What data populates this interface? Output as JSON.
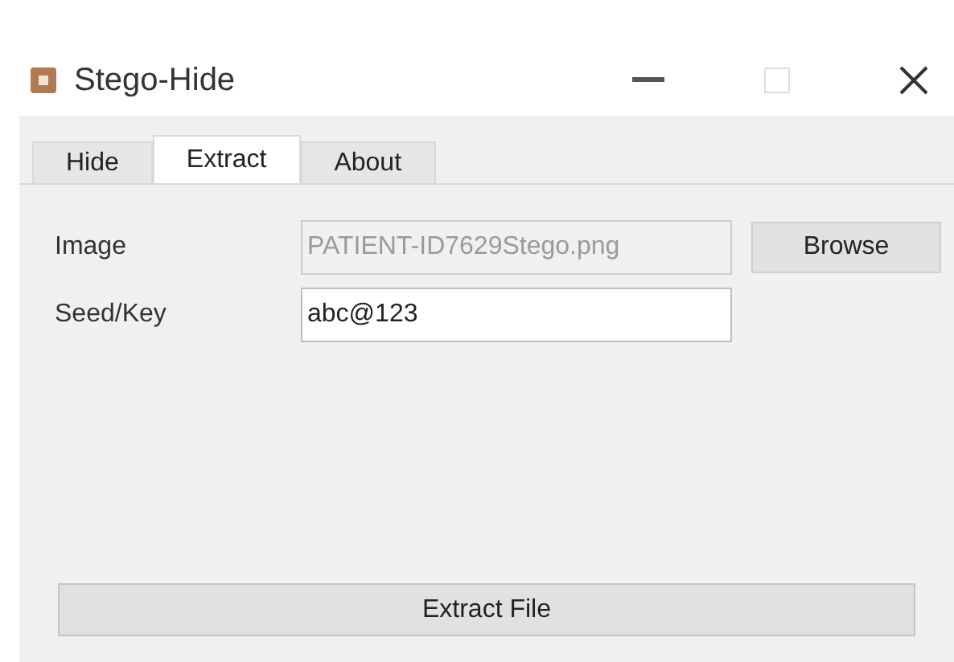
{
  "window": {
    "title": "Stego-Hide"
  },
  "tabs": [
    {
      "label": "Hide",
      "selected": false
    },
    {
      "label": "Extract",
      "selected": true
    },
    {
      "label": "About",
      "selected": false
    }
  ],
  "fields": [
    {
      "label": "Image",
      "value": "PATIENT-ID7629Stego.png",
      "disabled": true,
      "button": "Browse"
    },
    {
      "label": "Seed/Key",
      "value": "abc@123",
      "disabled": false
    }
  ],
  "action_button": "Extract File"
}
